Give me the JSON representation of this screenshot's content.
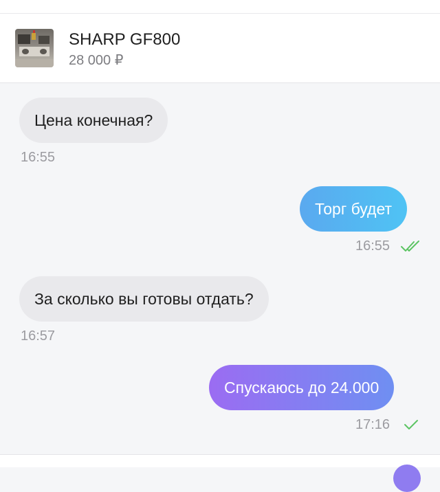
{
  "listing": {
    "title": "SHARP GF800",
    "price": "28 000 ₽",
    "thumbnail_icon": "product-photo"
  },
  "messages": [
    {
      "direction": "incoming",
      "text": "Цена конечная?",
      "time": "16:55"
    },
    {
      "direction": "outgoing",
      "text": "Торг будет",
      "time": "16:55",
      "status": "double-check-icon"
    },
    {
      "direction": "incoming",
      "text": "За сколько вы готовы отдать?",
      "time": "16:57"
    },
    {
      "direction": "outgoing",
      "text": "Спускаюсь до 24.000",
      "time": "17:16",
      "status": "check-icon"
    }
  ],
  "colors": {
    "outgoing_blue": "#4fb5f2",
    "outgoing_purple": "#8a7cf2",
    "incoming_bubble": "#e9e9ec",
    "check_green": "#5cc463"
  }
}
